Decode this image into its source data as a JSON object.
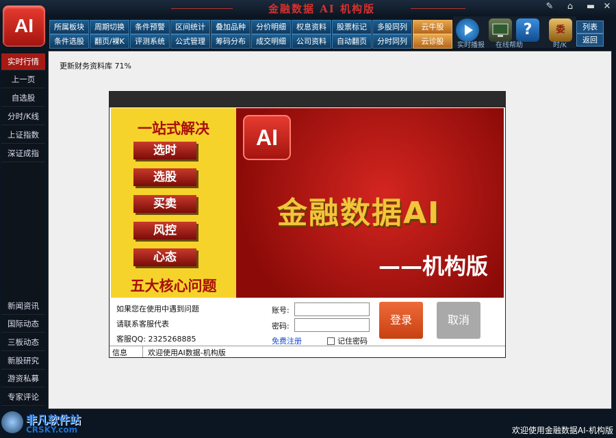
{
  "window": {
    "title": "金融数据 AI  机构版",
    "logo": "AI",
    "wrench_icon": "✎",
    "home_icon": "⌂",
    "min_icon": "▬",
    "close_icon": "✕"
  },
  "menu": {
    "row1": [
      "所属板块",
      "周期切换",
      "条件预警",
      "区间统计",
      "叠加品种",
      "分价明细",
      "权息资料",
      "股票标记",
      "多股同列",
      "云牛股"
    ],
    "row2": [
      "条件选股",
      "翻页/裸K",
      "评测系统",
      "公式管理",
      "筹码分布",
      "成交明细",
      "公司资料",
      "自动翻页",
      "分时同列",
      "云诊股"
    ]
  },
  "toolbar": {
    "label1": "实时播报",
    "label2": "在线帮助",
    "label3": "时/K",
    "list": "列表",
    "back": "返回",
    "help_glyph": "?",
    "book_glyph": "委"
  },
  "sidebar": {
    "top": [
      "实时行情",
      "上一页",
      "自选股",
      "分时/K线",
      "上证指数",
      "深证成指"
    ],
    "bottom": [
      "新闻资讯",
      "国际动态",
      "三板动态",
      "新股研究",
      "游资私募",
      "专家评论"
    ]
  },
  "progress": {
    "text": "更新财务资料库 71%",
    "percent": 71
  },
  "banner": {
    "slogan": "一站式解决",
    "buttons": [
      "选时",
      "选股",
      "买卖",
      "风控",
      "心态"
    ],
    "core": "五大核心问题",
    "ai_badge": "AI",
    "brand": "金融数据AI",
    "edition": "——机构版"
  },
  "login": {
    "help1": "如果您在使用中遇到问题",
    "help2": "请联系客服代表",
    "qq": "客服QQ: 2325268885",
    "account_label": "账号:",
    "password_label": "密码:",
    "account_value": "",
    "password_value": "",
    "register": "免费注册",
    "remember": "记住密码",
    "login_button": "登录",
    "cancel_button": "取消"
  },
  "info": {
    "label": "信息",
    "message": "欢迎使用AI数据-机构版"
  },
  "status": {
    "message": "欢迎使用金融数据AI-机构版"
  },
  "watermark": {
    "line1": "非凡软件站",
    "line2": "CRSKY.com"
  }
}
